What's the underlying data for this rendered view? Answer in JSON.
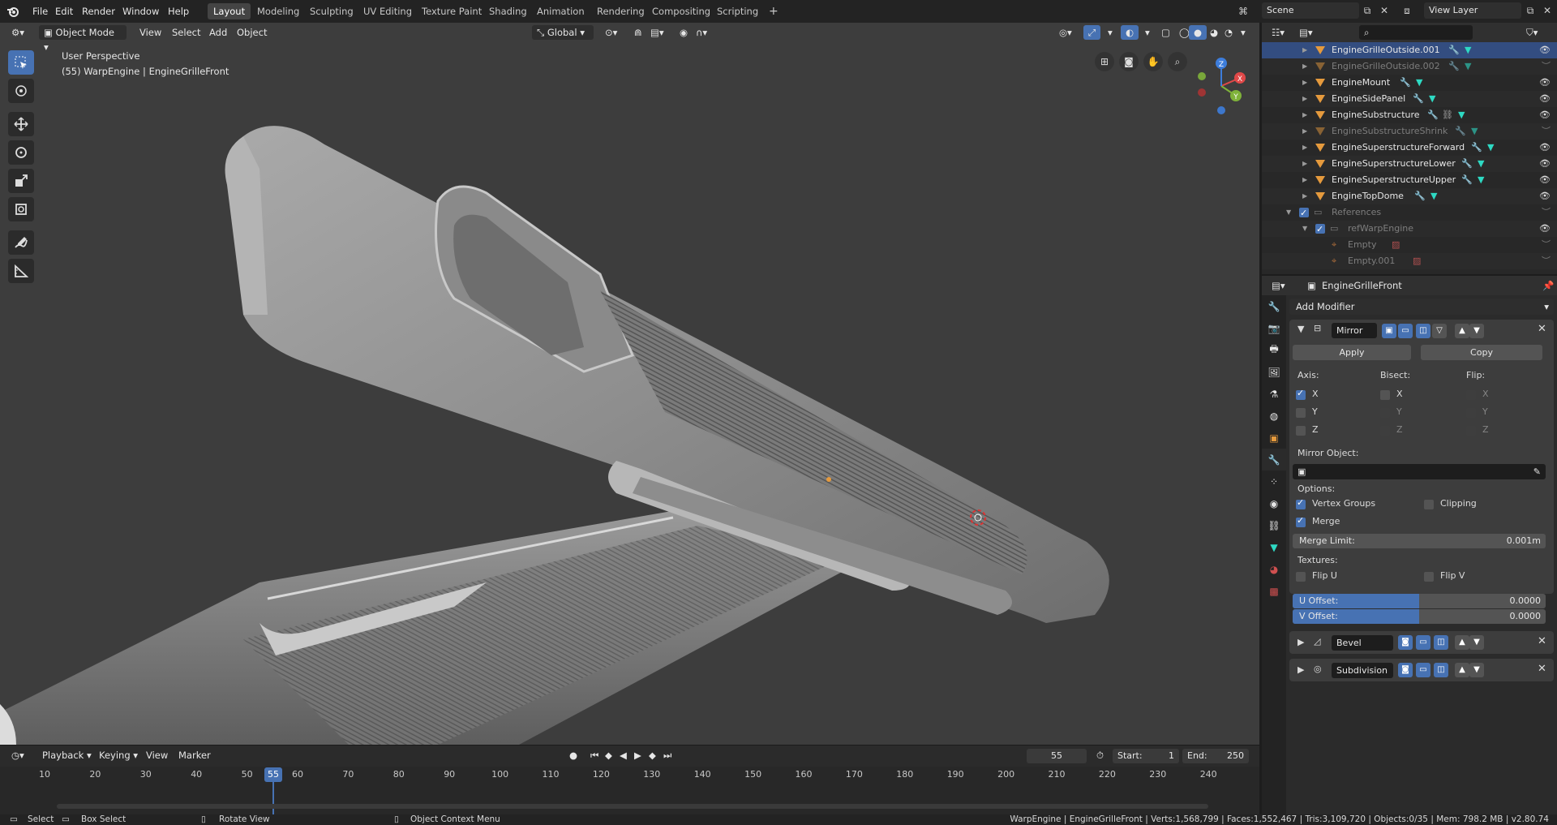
{
  "topbar": {
    "menus": [
      "File",
      "Edit",
      "Render",
      "Window",
      "Help"
    ],
    "workspaces": [
      "Layout",
      "Modeling",
      "Sculpting",
      "UV Editing",
      "Texture Paint",
      "Shading",
      "Animation",
      "Rendering",
      "Compositing",
      "Scripting"
    ],
    "active_workspace": "Layout",
    "add_workspace": "+",
    "scene": "Scene",
    "view_layer": "View Layer"
  },
  "viewport": {
    "mode": "Object Mode",
    "menus": [
      "View",
      "Select",
      "Add",
      "Object"
    ],
    "orientation": "Global",
    "overlay_line1": "User Perspective",
    "overlay_line2": "(55) WarpEngine | EngineGrilleFront",
    "gizmo": {
      "x": "X",
      "y": "Y",
      "z": "Z"
    }
  },
  "timeline": {
    "menus": [
      "Playback",
      "Keying",
      "View",
      "Marker"
    ],
    "current_frame": "55",
    "start_label": "Start:",
    "start": "1",
    "end_label": "End:",
    "end": "250",
    "ticks": [
      "10",
      "20",
      "30",
      "40",
      "50",
      "60",
      "70",
      "80",
      "90",
      "100",
      "110",
      "120",
      "130",
      "140",
      "150",
      "160",
      "170",
      "180",
      "190",
      "200",
      "210",
      "220",
      "230",
      "240"
    ]
  },
  "statusbar": {
    "select": "Select",
    "box_select": "Box Select",
    "rotate_view": "Rotate View",
    "context_menu": "Object Context Menu",
    "stats": "WarpEngine | EngineGrilleFront | Verts:1,568,799 | Faces:1,552,467 | Tris:3,109,720 | Objects:0/35 | Mem: 798.2 MB | v2.80.74"
  },
  "outliner": {
    "items": [
      {
        "name": "EngineGrilleOutside.001",
        "state": "selected"
      },
      {
        "name": "EngineGrilleOutside.002",
        "state": "hidden"
      },
      {
        "name": "EngineMount",
        "state": "normal"
      },
      {
        "name": "EngineSidePanel",
        "state": "normal"
      },
      {
        "name": "EngineSubstructure",
        "state": "normal"
      },
      {
        "name": "EngineSubstructureShrink",
        "state": "hidden"
      },
      {
        "name": "EngineSuperstructureForward",
        "state": "normal"
      },
      {
        "name": "EngineSuperstructureLower",
        "state": "normal"
      },
      {
        "name": "EngineSuperstructureUpper",
        "state": "normal"
      },
      {
        "name": "EngineTopDome",
        "state": "normal"
      }
    ],
    "references": "References",
    "ref_collection": "refWarpEngine",
    "empties": [
      "Empty",
      "Empty.001"
    ]
  },
  "properties": {
    "object_name": "EngineGrilleFront",
    "add_modifier": "Add Modifier",
    "mirror": {
      "name": "Mirror",
      "apply": "Apply",
      "copy": "Copy",
      "axis_label": "Axis:",
      "bisect_label": "Bisect:",
      "flip_label": "Flip:",
      "axes": [
        "X",
        "Y",
        "Z"
      ],
      "mirror_object_label": "Mirror Object:",
      "options_label": "Options:",
      "vertex_groups": "Vertex Groups",
      "clipping": "Clipping",
      "merge": "Merge",
      "merge_limit_label": "Merge Limit:",
      "merge_limit": "0.001m",
      "textures_label": "Textures:",
      "flip_u": "Flip U",
      "flip_v": "Flip V",
      "u_offset_label": "U Offset:",
      "u_offset": "0.0000",
      "v_offset_label": "V Offset:",
      "v_offset": "0.0000"
    },
    "bevel": "Bevel",
    "subdivision": "Subdivision"
  }
}
